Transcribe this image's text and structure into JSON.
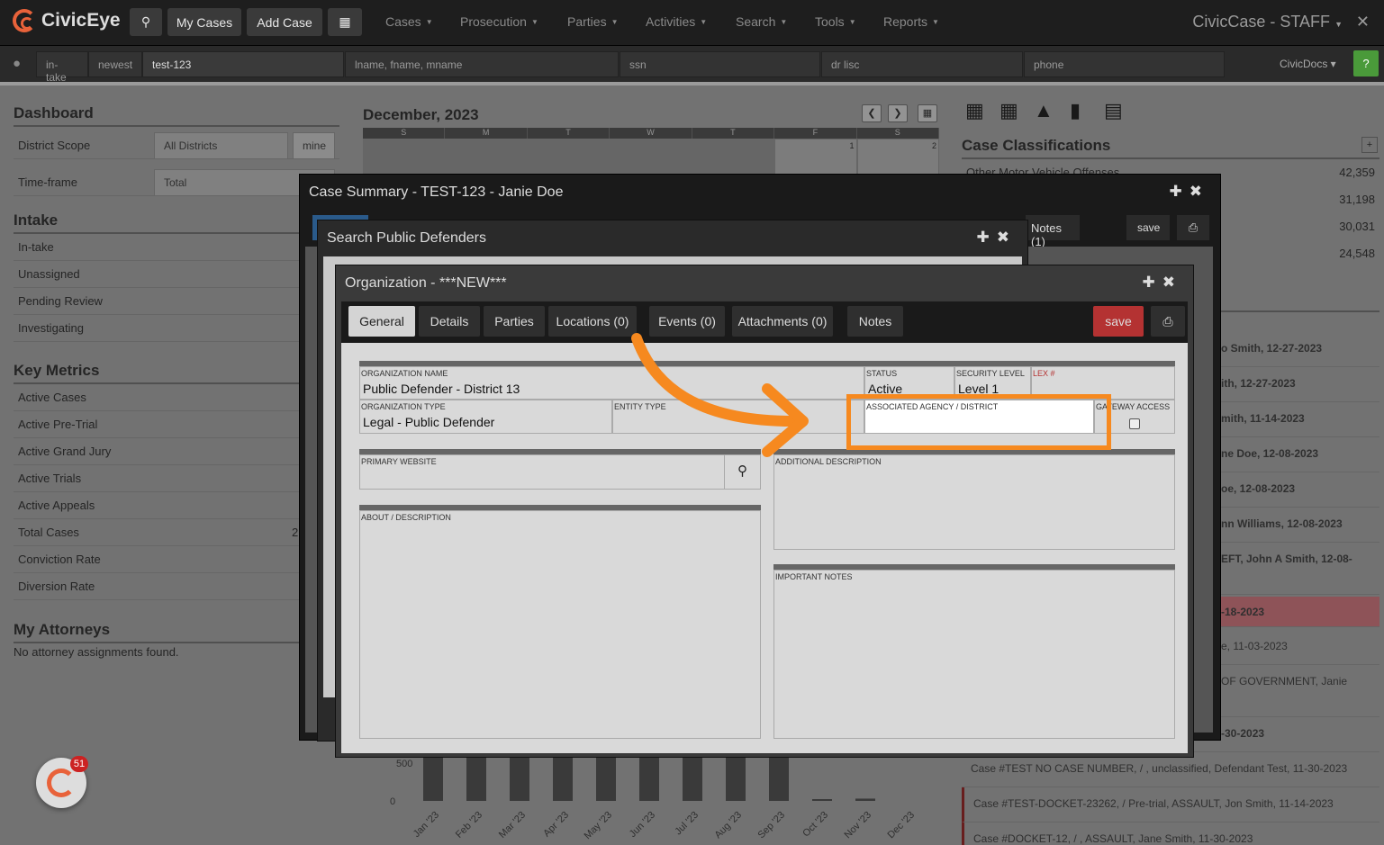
{
  "nav": {
    "brand": "CivicEye",
    "my_cases": "My Cases",
    "add_case": "Add Case",
    "menus": [
      "Cases",
      "Prosecution",
      "Parties",
      "Activities",
      "Search",
      "Tools",
      "Reports"
    ],
    "title": "CivicCase - STAFF",
    "close": "✕"
  },
  "searchbar": {
    "intake": "in-take",
    "newest": "newest",
    "case_value": "test-123",
    "name_ph": "lname, fname, mname",
    "ssn_ph": "ssn",
    "dl_ph": "dr lisc",
    "phone_ph": "phone",
    "docs": "CivicDocs",
    "help": "?"
  },
  "dashboard": {
    "title": "Dashboard",
    "district_scope": "District Scope",
    "district_value": "All Districts",
    "mine": "mine",
    "timeframe": "Time-frame",
    "timeframe_value": "Total"
  },
  "intake": {
    "title": "Intake",
    "items": [
      "In-take",
      "Unassigned",
      "Pending Review",
      "Investigating"
    ]
  },
  "metrics": {
    "title": "Key Metrics",
    "items": [
      "Active Cases",
      "Active Pre-Trial",
      "Active Grand Jury",
      "Active Trials",
      "Active Appeals",
      "Total Cases",
      "Conviction Rate",
      "Diversion Rate"
    ],
    "total_cases_value": "2"
  },
  "attorneys": {
    "title": "My Attorneys",
    "empty": "No attorney assignments found."
  },
  "calendar": {
    "title": "December, 2023",
    "days": [
      "S",
      "M",
      "T",
      "W",
      "T",
      "F",
      "S"
    ],
    "dates": [
      "",
      "",
      "",
      "",
      "",
      "1",
      "2"
    ]
  },
  "classifications": {
    "title": "Case Classifications",
    "items": [
      {
        "label": "Other Motor Vehicle Offenses",
        "value": "42,359"
      },
      {
        "label": "",
        "value": "31,198"
      },
      {
        "label": "",
        "value": "30,031"
      },
      {
        "label": "",
        "value": "24,548"
      }
    ]
  },
  "recent": [
    {
      "text": "o Smith, 12-27-2023"
    },
    {
      "text": "ith, 12-27-2023"
    },
    {
      "text": "mith, 11-14-2023"
    },
    {
      "text": "ne Doe, 12-08-2023"
    },
    {
      "text": "oe, 12-08-2023"
    },
    {
      "text": "nn Williams, 12-08-2023"
    },
    {
      "text": "EFT, John A Smith, 12-08-"
    },
    {
      "text": "-18-2023"
    },
    {
      "text": "e, 11-03-2023"
    },
    {
      "text": "OF GOVERNMENT, Janie"
    },
    {
      "text": "-30-2023"
    },
    {
      "text": "Case #TEST NO CASE NUMBER, / , unclassified, Defendant Test, 11-30-2023"
    },
    {
      "text": "Case #TEST-DOCKET-23262, / Pre-trial, ASSAULT, Jon Smith, 11-14-2023"
    },
    {
      "text": "Case #DOCKET-12, / , ASSAULT, Jane Smith, 11-30-2023"
    }
  ],
  "chart_data": {
    "type": "bar",
    "categories": [
      "Jan '23",
      "Feb '23",
      "Mar '23",
      "Apr '23",
      "May '23",
      "Jun '23",
      "Jul '23",
      "Aug '23",
      "Sep '23",
      "Oct '23",
      "Nov '23",
      "Dec '23"
    ],
    "values": [
      560,
      560,
      560,
      560,
      560,
      560,
      560,
      560,
      560,
      10,
      30,
      0
    ],
    "yticks": [
      "500",
      "0"
    ]
  },
  "case_summary": {
    "title": "Case Summary - TEST-123 - Janie Doe",
    "notes": "Notes (1)",
    "save": "save"
  },
  "search_pd": {
    "title": "Search Public Defenders"
  },
  "org": {
    "title": "Organization - ***NEW***",
    "tabs": [
      "General",
      "Details",
      "Parties",
      "Locations (0)",
      "Events (0)",
      "Attachments (0)",
      "Notes"
    ],
    "save": "save",
    "fields": {
      "org_name_lbl": "ORGANIZATION NAME",
      "org_name": "Public Defender - District 13",
      "status_lbl": "STATUS",
      "status": "Active",
      "security_lbl": "SECURITY LEVEL",
      "security": "Level 1",
      "lex_lbl": "LEX #",
      "org_type_lbl": "ORGANIZATION TYPE",
      "org_type": "Legal - Public Defender",
      "entity_lbl": "ENTITY TYPE",
      "agency_lbl": "ASSOCIATED AGENCY / DISTRICT",
      "gateway_lbl": "GATEWAY ACCESS",
      "website_lbl": "PRIMARY WEBSITE",
      "addl_lbl": "ADDITIONAL DESCRIPTION",
      "about_lbl": "ABOUT / DESCRIPTION",
      "important_lbl": "IMPORTANT NOTES"
    }
  },
  "badge": {
    "count": "51"
  }
}
